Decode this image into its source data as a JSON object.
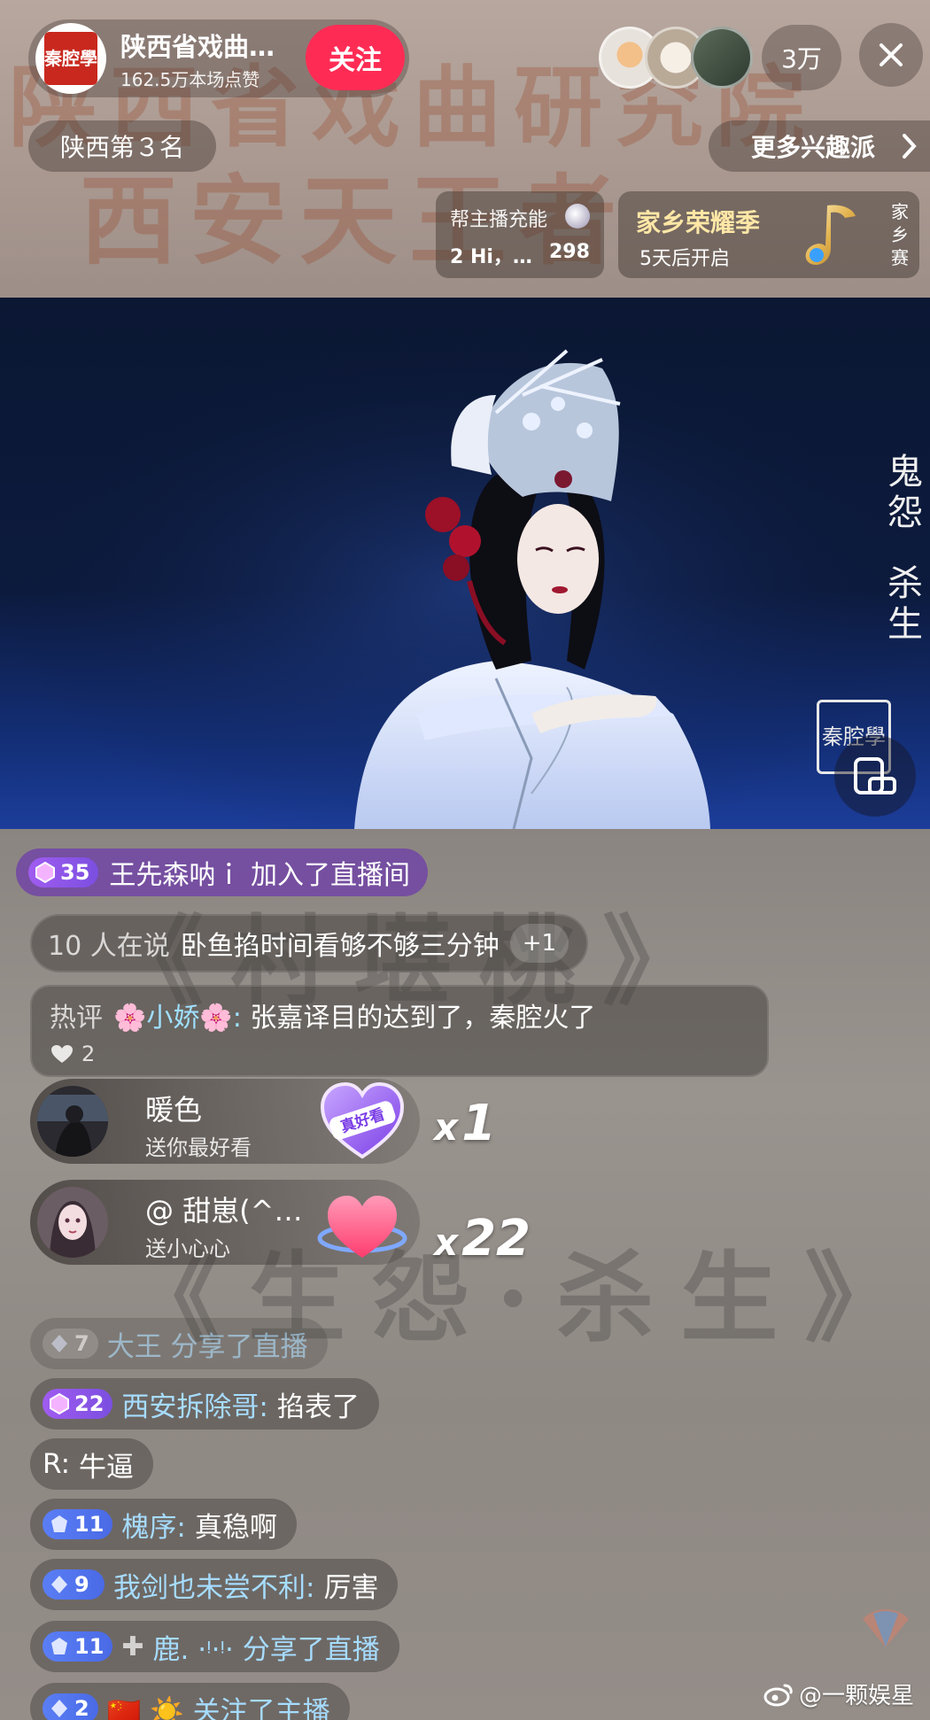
{
  "header": {
    "anchor_name": "陕西省戏曲…",
    "anchor_likes": "162.5万本场点赞",
    "avatar_seal": "秦腔學",
    "follow_label": "关注",
    "viewer_count": "3万"
  },
  "subheader": {
    "rank_label": "陕西第３名",
    "more_label": "更多兴趣派"
  },
  "charge_card": {
    "title": "帮主播充能",
    "subtitle": "2 Hi，…",
    "count": "298"
  },
  "season_card": {
    "title": "家乡荣耀季",
    "subtitle": "5天后开启",
    "side_text": "家乡赛"
  },
  "video": {
    "caption_top": "鬼怨",
    "caption_bottom": "杀生",
    "seal_text": "秦腔學"
  },
  "chat": {
    "join": {
      "level": "35",
      "user": "王先森呐ｉ",
      "action": "加入了直播间"
    },
    "talk": {
      "count": "10 人在说",
      "text": "卧鱼掐时间看够不够三分钟",
      "plus": "+1"
    },
    "hot": {
      "tag": "热评",
      "user": "🌸小娇🌸:",
      "text": "张嘉译目的达到了，秦腔火了",
      "likes": "2"
    },
    "gifts": [
      {
        "name": "暖色",
        "desc": "送你最好看",
        "gift_label": "真好看",
        "multiplier": "1"
      },
      {
        "name": "@ 甜崽(^…",
        "desc": "送小心心",
        "multiplier": "22"
      }
    ],
    "messages": [
      {
        "level": "7",
        "user": "大王 分享了直播",
        "text": ""
      },
      {
        "level": "22",
        "user": "西安拆除哥:",
        "text": "掐表了"
      },
      {
        "level": "",
        "user": "R:",
        "text": "牛逼"
      },
      {
        "level": "11",
        "user": "槐序:",
        "text": "真稳啊"
      },
      {
        "level": "9",
        "user": "我剑也未尝不利:",
        "text": "厉害"
      },
      {
        "level": "11",
        "user": "鹿. ·ᵎ·ᵎ· 分享了直播",
        "text": ""
      },
      {
        "level": "2",
        "user": "🇨🇳 ☀️ 关注了主播",
        "text": ""
      }
    ]
  },
  "watermark": "@一颗娱星",
  "colors": {
    "follow": "#fe2c55",
    "level_purple": "#8f55ec",
    "level_blue": "#5a7ef5",
    "username": "#a6dcff"
  }
}
